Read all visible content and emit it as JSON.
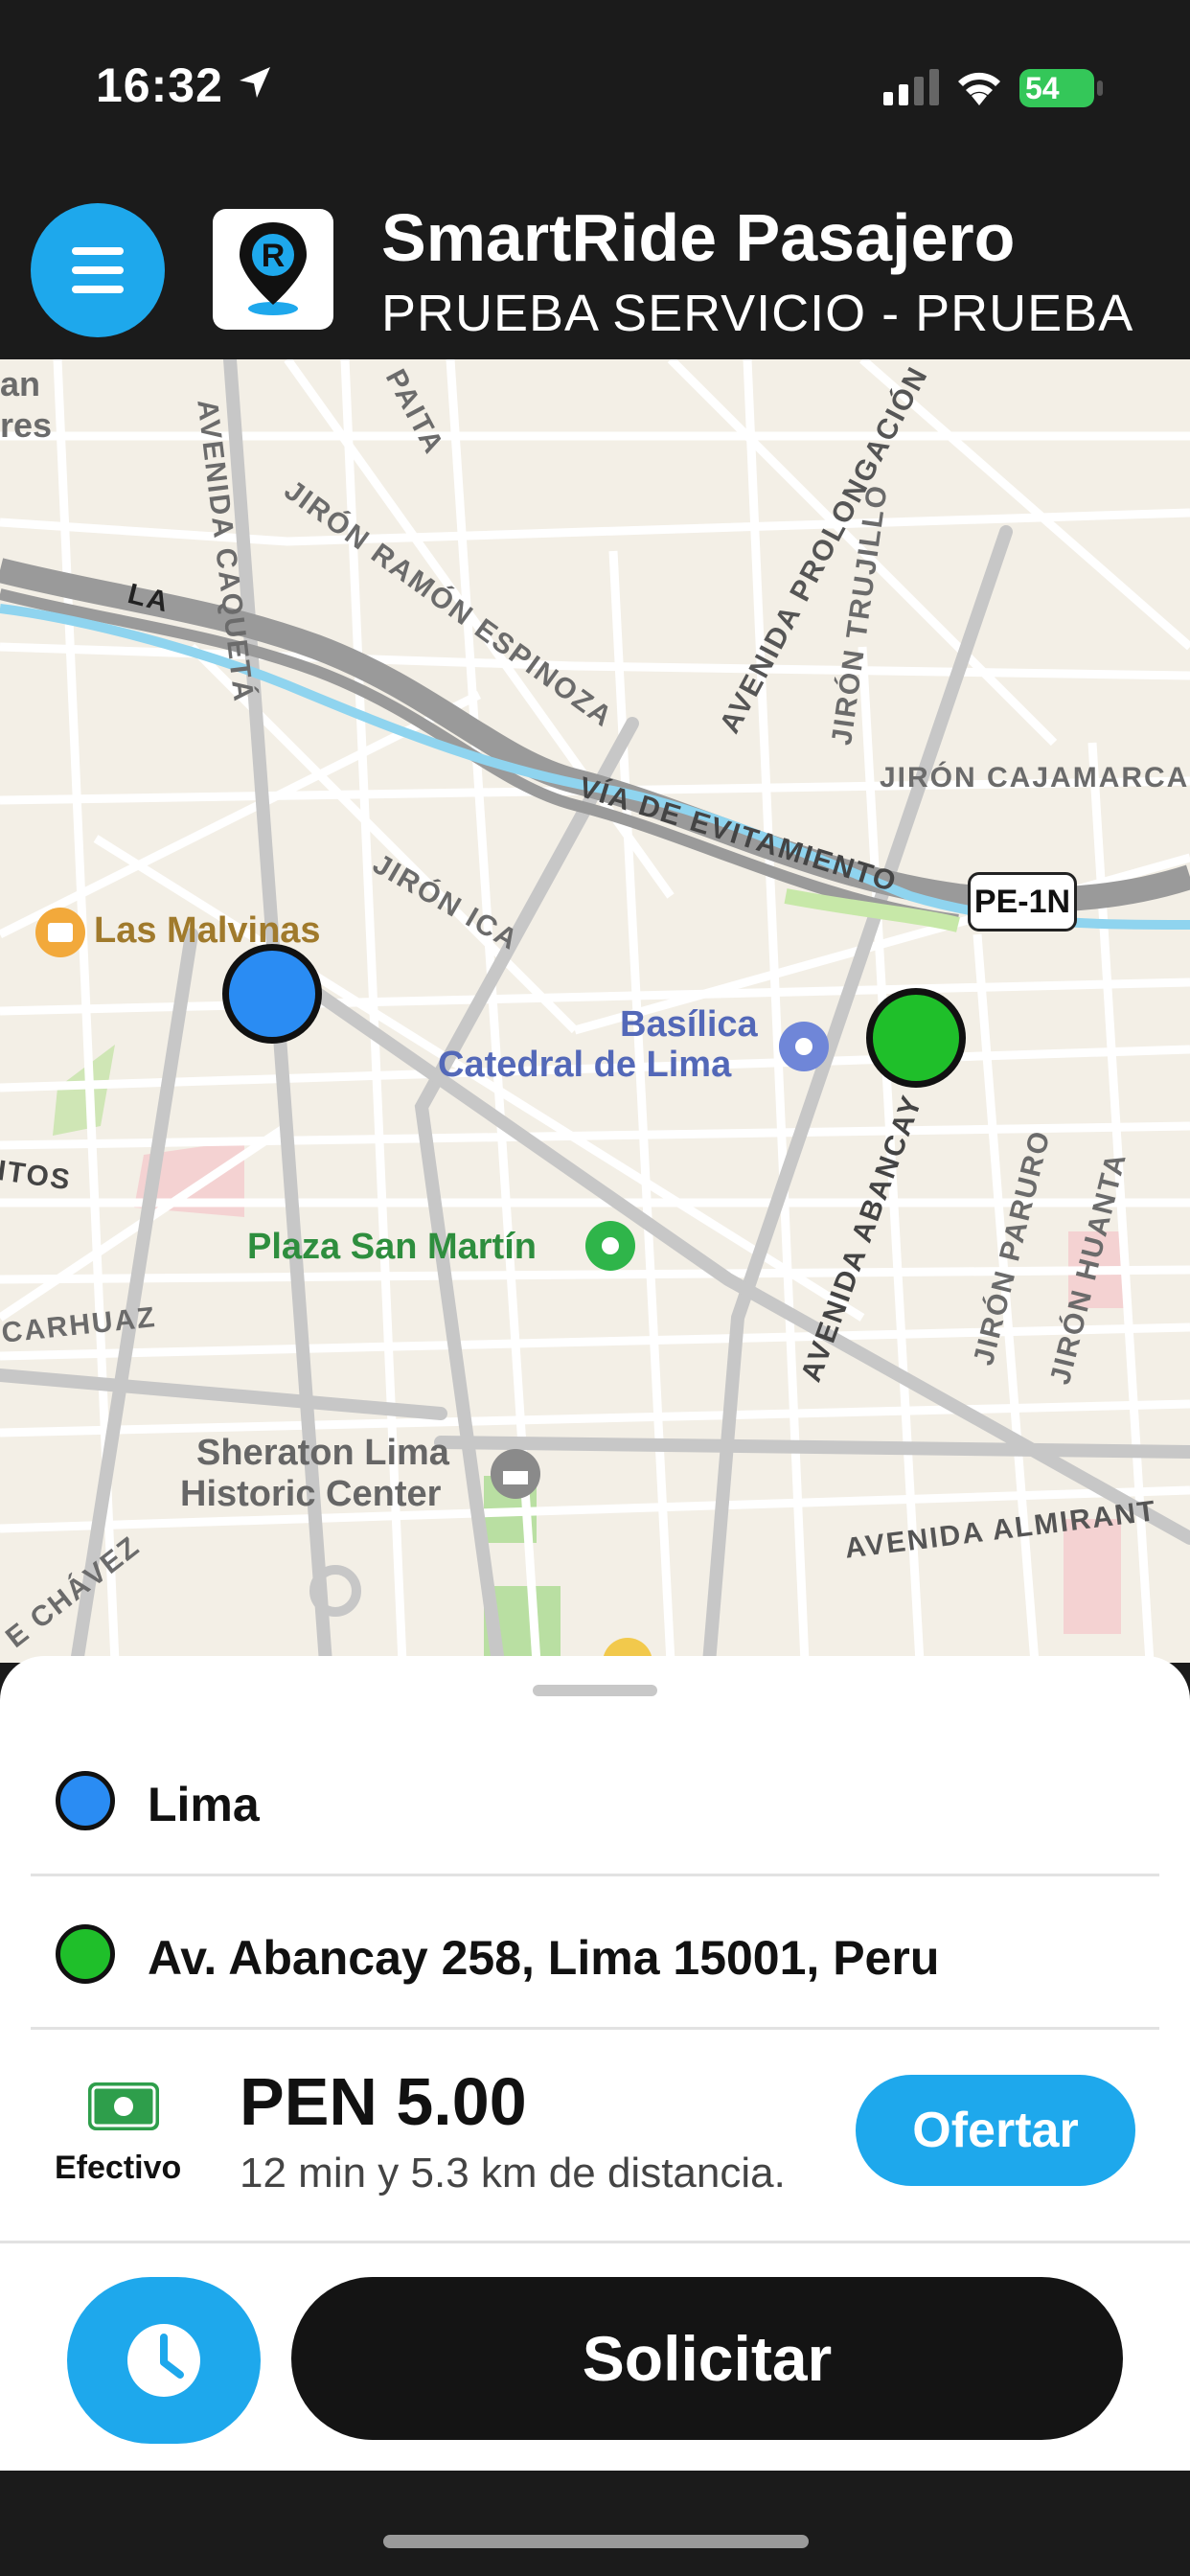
{
  "status_bar": {
    "time": "16:32",
    "battery": "54"
  },
  "header": {
    "app_title": "SmartRide Pasajero",
    "subtitle": "PRUEBA SERVICIO - PRUEBA",
    "logo_letter": "R",
    "accent_color": "#1ea8ec"
  },
  "map": {
    "streets": [
      "AVENIDA CAQUETÁ",
      "JIRÓN RAMÓN ESPINOZA",
      "PAITA",
      "AVENIDA PROLONGACIÓN",
      "JIRÓN TRUJILLO",
      "JIRÓN CAJAMARCA",
      "VÍA DE EVITAMIENTO",
      "JIRÓN ICA",
      "LA",
      "AVENIDA ABANCAY",
      "JIRÓN PARURO",
      "JIRÓN HUANTA",
      "AVENIDA ALMIRANT",
      "CARHUAZ",
      "ITOS",
      "E CHÁVEZ",
      "an",
      "res"
    ],
    "route_shield": "PE-1N",
    "pois": {
      "malvinas": "Las Malvinas",
      "basilica_line1": "Basílica",
      "basilica_line2": "Catedral de Lima",
      "plaza": "Plaza San Martín",
      "sheraton_line1": "Sheraton Lima",
      "sheraton_line2": "Historic Center"
    },
    "origin_color": "#2a8cf3",
    "destination_color": "#1fbf2a"
  },
  "trip": {
    "origin": "Lima",
    "destination": "Av. Abancay 258, Lima 15001, Peru",
    "payment_method": "Efectivo",
    "price": "PEN 5.00",
    "eta": "12 min y 5.3 km de distancia.",
    "offer_label": "Ofertar",
    "request_label": "Solicitar"
  }
}
